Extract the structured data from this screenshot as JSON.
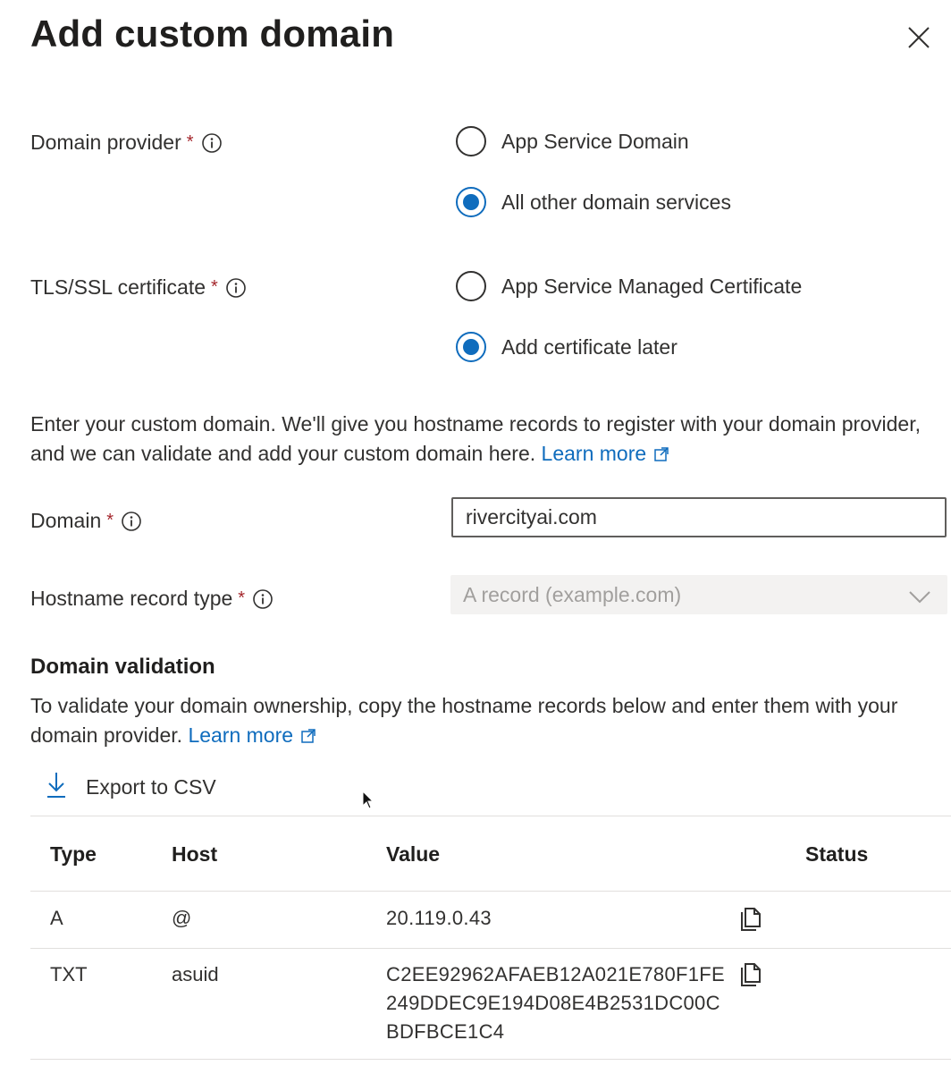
{
  "panel": {
    "title": "Add custom domain"
  },
  "domain_provider": {
    "label": "Domain provider",
    "required_mark": "*",
    "options": [
      "App Service Domain",
      "All other domain services"
    ],
    "selected": "All other domain services"
  },
  "tls_certificate": {
    "label": "TLS/SSL certificate",
    "required_mark": "*",
    "options": [
      "App Service Managed Certificate",
      "Add certificate later"
    ],
    "selected": "Add certificate later"
  },
  "intro": {
    "text": "Enter your custom domain. We'll give you hostname records to register with your domain provider, and we can validate and add your custom domain here.",
    "link": "Learn more"
  },
  "domain": {
    "label": "Domain",
    "required_mark": "*",
    "value": "rivercityai.com"
  },
  "hostname_record_type": {
    "label": "Hostname record type",
    "required_mark": "*",
    "value": "A record (example.com)"
  },
  "validation": {
    "title": "Domain validation",
    "text": "To validate your domain ownership, copy the hostname records below and enter them with your domain provider.",
    "link": "Learn more",
    "export_label": "Export to CSV"
  },
  "records_table": {
    "headers": [
      "Type",
      "Host",
      "Value",
      "Status"
    ],
    "rows": [
      {
        "type": "A",
        "host": "@",
        "value_lines": [
          "20.119.0.43"
        ]
      },
      {
        "type": "TXT",
        "host": "asuid",
        "value_lines": [
          "C2EE92962AFAEB12A021E780F1FE",
          "249DDEC9E194D08E4B2531DC00C",
          "BDFBCE1C4"
        ]
      }
    ]
  },
  "colors": {
    "accent": "#0f6cbd",
    "required": "#a4262c",
    "text": "#323130",
    "disabled_bg": "#f3f2f1"
  }
}
